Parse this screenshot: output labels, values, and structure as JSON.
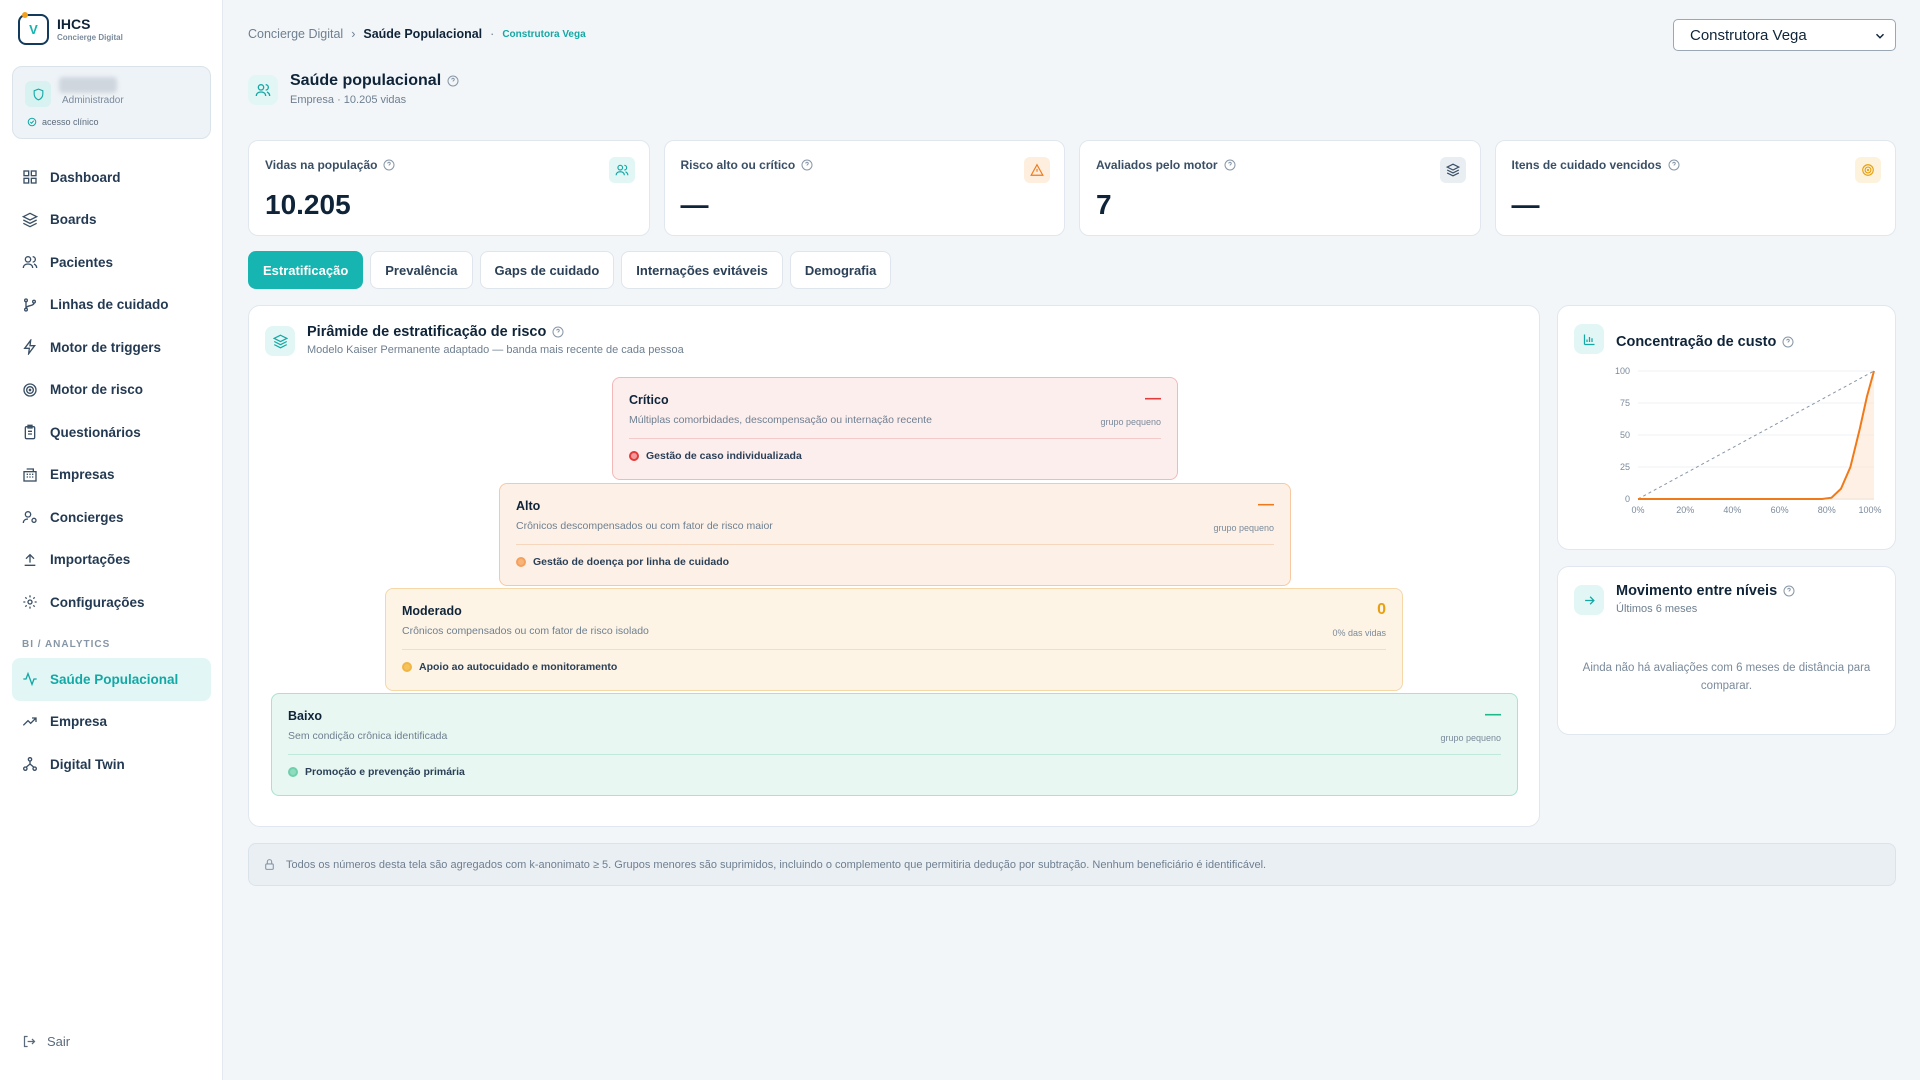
{
  "brand": {
    "name": "IHCS",
    "subtitle": "Concierge Digital",
    "logo_letter": "V"
  },
  "user": {
    "role": "Administrador",
    "access": "acesso clínico"
  },
  "nav": {
    "items": [
      {
        "label": "Dashboard",
        "icon": "grid-icon"
      },
      {
        "label": "Boards",
        "icon": "layers-icon"
      },
      {
        "label": "Pacientes",
        "icon": "users-icon"
      },
      {
        "label": "Linhas de cuidado",
        "icon": "branch-icon"
      },
      {
        "label": "Motor de triggers",
        "icon": "bolt-icon"
      },
      {
        "label": "Motor de risco",
        "icon": "target-icon"
      },
      {
        "label": "Questionários",
        "icon": "clipboard-icon"
      },
      {
        "label": "Empresas",
        "icon": "building-icon"
      },
      {
        "label": "Concierges",
        "icon": "user-cog-icon"
      },
      {
        "label": "Importações",
        "icon": "upload-icon"
      },
      {
        "label": "Configurações",
        "icon": "gear-icon"
      }
    ],
    "section_label": "BI / ANALYTICS",
    "analytics": [
      {
        "label": "Saúde Populacional",
        "icon": "activity-icon",
        "active": true
      },
      {
        "label": "Empresa",
        "icon": "trend-icon"
      },
      {
        "label": "Digital Twin",
        "icon": "network-icon"
      }
    ],
    "logout": "Sair"
  },
  "breadcrumb": {
    "root": "Concierge Digital",
    "current": "Saúde Populacional",
    "tag": "Construtora Vega"
  },
  "company_select": {
    "value": "Construtora Vega"
  },
  "header": {
    "title": "Saúde populacional",
    "subtitle": "Empresa · 10.205 vidas"
  },
  "kpis": [
    {
      "label": "Vidas na população",
      "value": "10.205",
      "icon": "users-icon",
      "color": "#14a8a5",
      "bg": "#e1f6f5"
    },
    {
      "label": "Risco alto ou crítico",
      "value": "—",
      "icon": "warning-icon",
      "color": "#f07a1a",
      "bg": "#fdeede"
    },
    {
      "label": "Avaliados pelo motor",
      "value": "7",
      "icon": "layers-icon",
      "color": "#3a4f65",
      "bg": "#e9eef3"
    },
    {
      "label": "Itens de cuidado vencidos",
      "value": "—",
      "icon": "target-icon",
      "color": "#e8a010",
      "bg": "#fdf3dc"
    }
  ],
  "tabs": [
    "Estratificação",
    "Prevalência",
    "Gaps de cuidado",
    "Internações evitáveis",
    "Demografia"
  ],
  "pyramid": {
    "title": "Pirâmide de estratificação de risco",
    "subtitle": "Modelo Kaiser Permanente adaptado — banda mais recente de cada pessoa",
    "tiers": [
      {
        "name": "Crítico",
        "desc": "Múltiplas comorbidades, descompensação ou internação recente",
        "value": "—",
        "note": "grupo pequeno",
        "action": "Gestão de caso individualizada",
        "color": "#e23b3b"
      },
      {
        "name": "Alto",
        "desc": "Crônicos descompensados ou com fator de risco maior",
        "value": "—",
        "note": "grupo pequeno",
        "action": "Gestão de doença por linha de cuidado",
        "color": "#f07a1a"
      },
      {
        "name": "Moderado",
        "desc": "Crônicos compensados ou com fator de risco isolado",
        "value": "0",
        "note": "0% das vidas",
        "action": "Apoio ao autocuidado e monitoramento",
        "color": "#e8a010"
      },
      {
        "name": "Baixo",
        "desc": "Sem condição crônica identificada",
        "value": "—",
        "note": "grupo pequeno",
        "action": "Promoção e prevenção primária",
        "color": "#1fb88a"
      }
    ]
  },
  "cost": {
    "title": "Concentração de custo",
    "chart_data": {
      "type": "line",
      "x_ticks": [
        "0%",
        "20%",
        "40%",
        "60%",
        "80%",
        "100%"
      ],
      "y_ticks": [
        "0",
        "25",
        "50",
        "75",
        "100"
      ],
      "ylim": [
        0,
        100
      ],
      "series": [
        {
          "points": [
            [
              0,
              0
            ],
            [
              78,
              0
            ],
            [
              82,
              1
            ],
            [
              86,
              8
            ],
            [
              90,
              25
            ],
            [
              94,
              55
            ],
            [
              97,
              80
            ],
            [
              100,
              100
            ]
          ],
          "color": "#f07a1a"
        }
      ]
    }
  },
  "movement": {
    "title": "Movimento entre níveis",
    "subtitle": "Últimos 6 meses",
    "empty": "Ainda não há avaliações com 6 meses de distância para comparar."
  },
  "footer": {
    "note": "Todos os números desta tela são agregados com k-anonimato ≥ 5. Grupos menores são suprimidos, incluindo o complemento que permitiria dedução por subtração. Nenhum beneficiário é identificável."
  }
}
